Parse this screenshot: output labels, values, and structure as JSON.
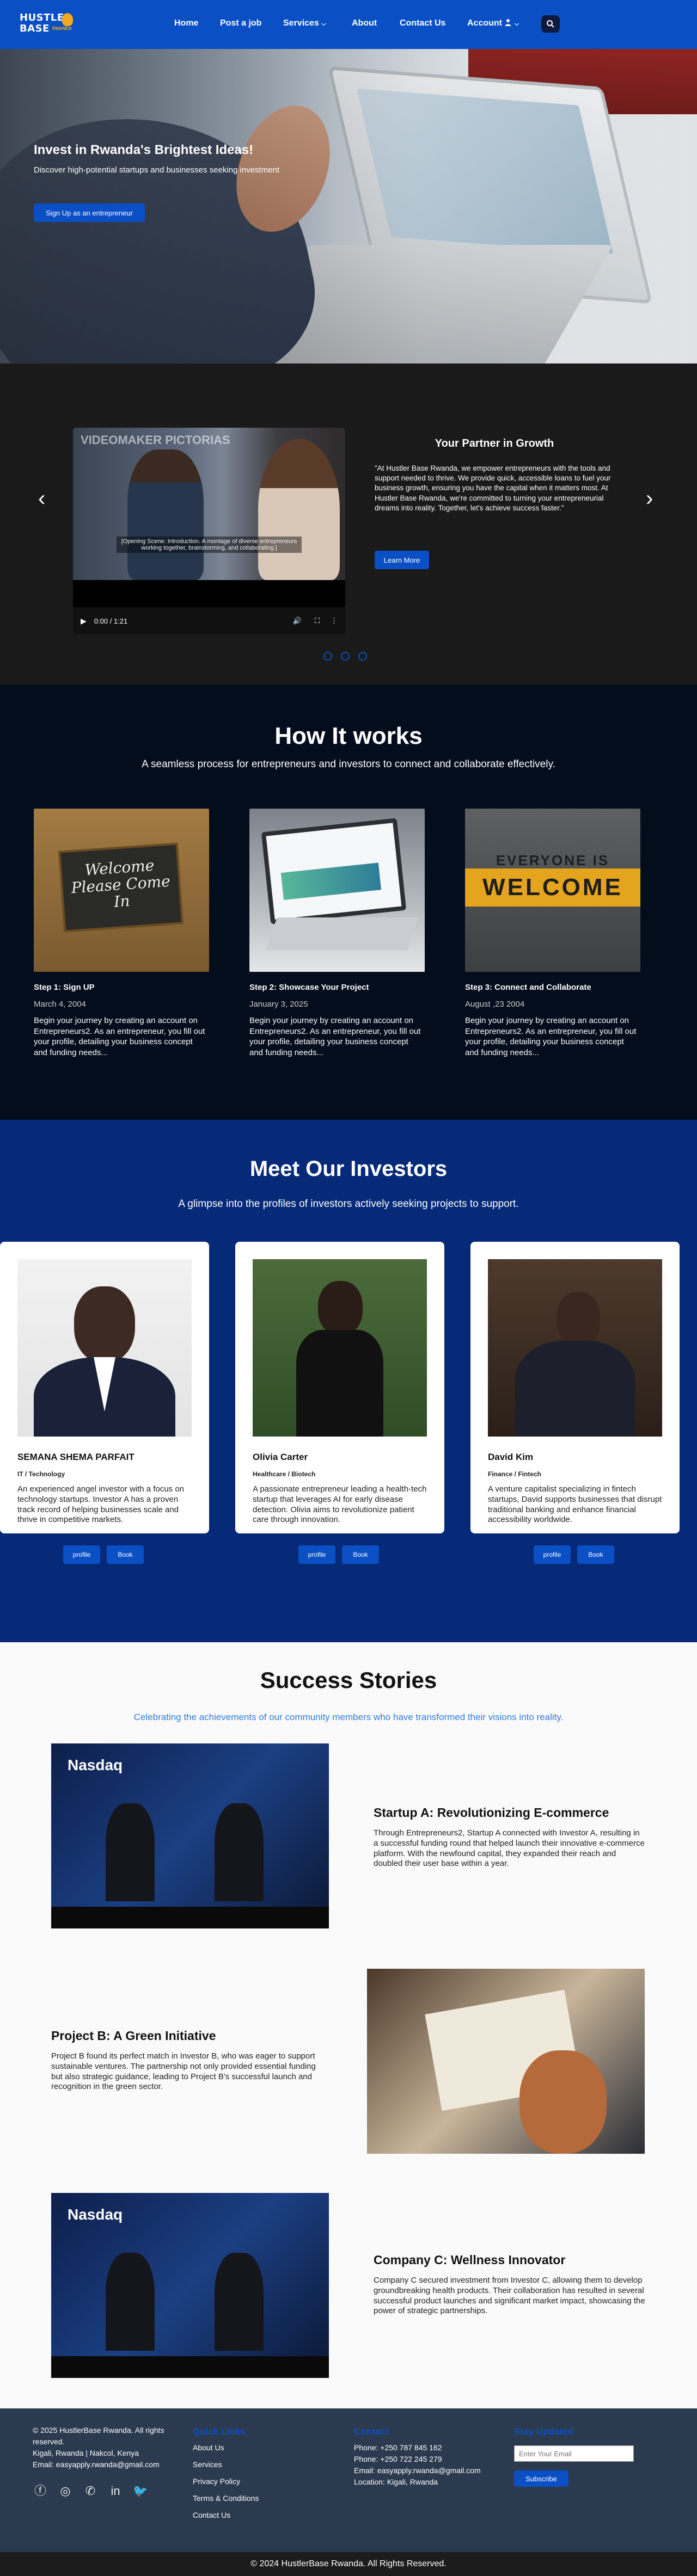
{
  "nav": {
    "logo_line1": "HUSTLE",
    "logo_line2": "BASE",
    "logo_sub": "RWANDA",
    "links": [
      "Home",
      "Post a job",
      "Services",
      "About",
      "Contact Us",
      "Account"
    ],
    "services_caret": "⌵",
    "account_caret": "⌵"
  },
  "hero": {
    "title": "Invest in Rwanda's Brightest Ideas!",
    "subtitle": "Discover high-potential startups and businesses seeking investment",
    "button": "Sign Up as an entrepreneur"
  },
  "partner": {
    "video_watermark": "VIDEOMAKER PICTORIAS",
    "video_caption": "[Opening Scene: Introduction. A montage of diverse entrepreneurs working together, brainstorming, and collaborating.]",
    "video_time": "0:00 / 1:21",
    "title": "Your Partner in Growth",
    "text": "\"At Hustler Base Rwanda, we empower entrepreneurs with the tools and support needed to thrive. We provide quick, accessible loans to fuel your business growth, ensuring you have the capital when it matters most. At Hustler Base Rwanda, we're committed to turning your entrepreneurial dreams into reality. Together, let's achieve success faster.\"",
    "button": "Learn More",
    "prev_arrow": "‹",
    "next_arrow": "›"
  },
  "how": {
    "title": "How It works",
    "subtitle": "A seamless process for entrepreneurs and investors to connect and collaborate effectively.",
    "steps": [
      {
        "title": "Step 1: Sign UP",
        "date": "March 4, 2004",
        "text": "Begin your journey by creating an account on Entrepreneurs2. As an entrepreneur, you fill out your profile, detailing your business concept and funding needs...",
        "img_text": "Welcome Please Come In"
      },
      {
        "title": "Step 2: Showcase Your Project",
        "date": "January 3, 2025",
        "text": "Begin your journey by creating an account on Entrepreneurs2. As an entrepreneur, you fill out your profile, detailing your business concept and funding needs..."
      },
      {
        "title": "Step 3: Connect and Collaborate",
        "date": "August ,23 2004",
        "text": "Begin your journey by creating an account on Entrepreneurs2. As an entrepreneur, you fill out your profile, detailing your business concept and funding needs...",
        "img_text_top": "EVERYONE IS",
        "img_text": "WELCOME"
      }
    ]
  },
  "investors": {
    "title": "Meet Our Investors",
    "subtitle": "A glimpse into the profiles of investors actively seeking projects to support.",
    "cards": [
      {
        "name": "SEMANA SHEMA PARFAIT",
        "field": "IT / Technology",
        "bio": "An experienced angel investor with a focus on technology startups. Investor A has a proven track record of helping businesses scale and thrive in competitive markets.",
        "btn1": "profile",
        "btn2": "Book"
      },
      {
        "name": "Olivia Carter",
        "field": "Healthcare / Biotech",
        "bio": "A passionate entrepreneur leading a health-tech startup that leverages AI for early disease detection. Olivia aims to revolutionize patient care through innovation.",
        "btn1": "profile",
        "btn2": "Book"
      },
      {
        "name": "David Kim",
        "field": "Finance / Fintech",
        "bio": "A venture capitalist specializing in fintech startups, David supports businesses that disrupt traditional banking and enhance financial accessibility worldwide.",
        "btn1": "profile",
        "btn2": "Book"
      }
    ]
  },
  "success": {
    "title": "Success Stories",
    "subtitle": "Celebrating the achievements of our community members who have transformed their visions into reality.",
    "stories": [
      {
        "title": "Startup A: Revolutionizing E-commerce",
        "text": "Through Entrepreneurs2, Startup A connected with Investor A, resulting in a successful funding round that helped launch their innovative e-commerce platform. With the newfound capital, they expanded their reach and doubled their user base within a year.",
        "img_text": "Nasdaq"
      },
      {
        "title": "Project B: A Green Initiative",
        "text": "Project B found its perfect match in Investor B, who was eager to support sustainable ventures. The partnership not only provided essential funding but also strategic guidance, leading to Project B's successful launch and recognition in the green sector."
      },
      {
        "title": "Company C: Wellness Innovator",
        "text": "Company C secured investment from Investor C, allowing them to develop groundbreaking health products. Their collaboration has resulted in several successful product launches and significant market impact, showcasing the power of strategic partnerships.",
        "img_text": "Nasdaq"
      }
    ]
  },
  "footer": {
    "copyright_lines": [
      "© 2025 HustlerBase Rwanda. All rights",
      "reserved."
    ],
    "address": "Kigali, Rwanda | Nakcol, Kenya",
    "email": "Email: easyapply.rwanda@gmail.com",
    "quick_links_head": "Quick Links",
    "quick_links": [
      "About Us",
      "Services",
      "Privacy Policy",
      "Terms & Conditions",
      "Contact Us"
    ],
    "contact_head": "Contact",
    "phone1": "Phone: +250 787 845 162",
    "phone2": "Phone: +250 722 245 279",
    "contact_email": "Email: easyapply.rwanda@gmail.com",
    "location": "Location: Kigali, Rwanda",
    "newsletter_head": "Stay Updated",
    "newsletter_placeholder": "Enter Your Email",
    "subscribe": "Subscribe",
    "social_icons": [
      "facebook-icon",
      "instagram-icon",
      "whatsapp-icon",
      "linkedin-icon",
      "twitter-icon"
    ],
    "bottom_bar": "© 2024 HustlerBase Rwanda. All Rights Reserved."
  },
  "colors": {
    "primary": "#0a4fc4",
    "nav": "#0a4fc4",
    "dark": "#040d1c",
    "investors_bg": "#062a78",
    "footer": "#2b3a4f",
    "accent_link": "#2f7ddb"
  }
}
